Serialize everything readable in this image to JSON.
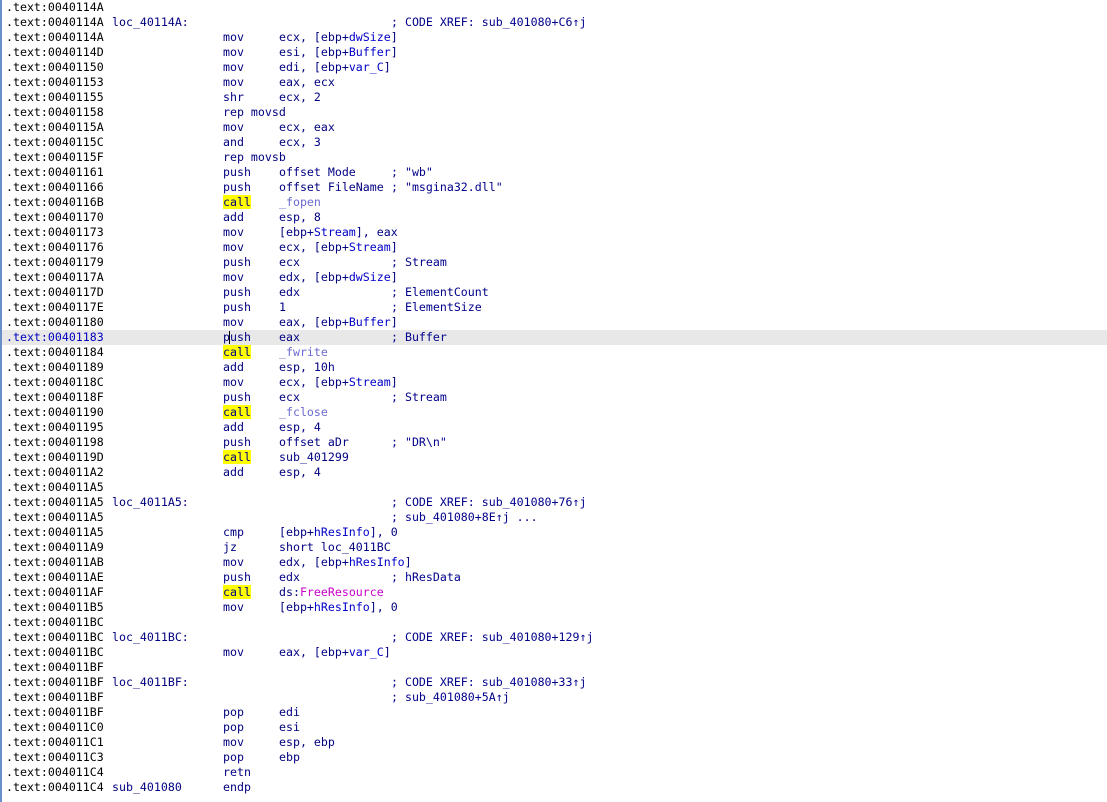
{
  "lines": [
    {
      "addr": ".text:0040114A"
    },
    {
      "addr": ".text:0040114A",
      "label": "loc_40114A:",
      "comment": "; CODE XREF: sub_401080+C6↑j"
    },
    {
      "addr": ".text:0040114A",
      "mnem": "mov",
      "ops": "ecx, [ebp+dwSize]"
    },
    {
      "addr": ".text:0040114D",
      "mnem": "mov",
      "ops": "esi, [ebp+Buffer]"
    },
    {
      "addr": ".text:00401150",
      "mnem": "mov",
      "ops": "edi, [ebp+var_C]"
    },
    {
      "addr": ".text:00401153",
      "mnem": "mov",
      "ops": "eax, ecx"
    },
    {
      "addr": ".text:00401155",
      "mnem": "shr",
      "ops": "ecx, 2"
    },
    {
      "addr": ".text:00401158",
      "mnem": "rep movsd"
    },
    {
      "addr": ".text:0040115A",
      "mnem": "mov",
      "ops": "ecx, eax"
    },
    {
      "addr": ".text:0040115C",
      "mnem": "and",
      "ops": "ecx, 3"
    },
    {
      "addr": ".text:0040115F",
      "mnem": "rep movsb"
    },
    {
      "addr": ".text:00401161",
      "mnem": "push",
      "ops": "offset Mode",
      "comment": "; \"wb\""
    },
    {
      "addr": ".text:00401166",
      "mnem": "push",
      "ops": "offset FileName",
      "comment": "; \"msgina32.dll\""
    },
    {
      "addr": ".text:0040116B",
      "mnem": "call",
      "ops": "_fopen",
      "call": true
    },
    {
      "addr": ".text:00401170",
      "mnem": "add",
      "ops": "esp, 8"
    },
    {
      "addr": ".text:00401173",
      "mnem": "mov",
      "ops": "[ebp+Stream], eax"
    },
    {
      "addr": ".text:00401176",
      "mnem": "mov",
      "ops": "ecx, [ebp+Stream]"
    },
    {
      "addr": ".text:00401179",
      "mnem": "push",
      "ops": "ecx",
      "comment": "; Stream"
    },
    {
      "addr": ".text:0040117A",
      "mnem": "mov",
      "ops": "edx, [ebp+dwSize]"
    },
    {
      "addr": ".text:0040117D",
      "mnem": "push",
      "ops": "edx",
      "comment": "; ElementCount"
    },
    {
      "addr": ".text:0040117E",
      "mnem": "push",
      "ops": "1",
      "comment": "; ElementSize"
    },
    {
      "addr": ".text:00401180",
      "mnem": "mov",
      "ops": "eax, [ebp+Buffer]"
    },
    {
      "addr": ".text:00401183",
      "mnem": "push",
      "ops": "eax",
      "comment": "; Buffer",
      "highlight": true
    },
    {
      "addr": ".text:00401184",
      "mnem": "call",
      "ops": "_fwrite",
      "call": true
    },
    {
      "addr": ".text:00401189",
      "mnem": "add",
      "ops": "esp, 10h"
    },
    {
      "addr": ".text:0040118C",
      "mnem": "mov",
      "ops": "ecx, [ebp+Stream]"
    },
    {
      "addr": ".text:0040118F",
      "mnem": "push",
      "ops": "ecx",
      "comment": "; Stream"
    },
    {
      "addr": ".text:00401190",
      "mnem": "call",
      "ops": "_fclose",
      "call": true
    },
    {
      "addr": ".text:00401195",
      "mnem": "add",
      "ops": "esp, 4"
    },
    {
      "addr": ".text:00401198",
      "mnem": "push",
      "ops": "offset aDr",
      "comment": "; \"DR\\n\""
    },
    {
      "addr": ".text:0040119D",
      "mnem": "call",
      "ops": "sub_401299",
      "call": true
    },
    {
      "addr": ".text:004011A2",
      "mnem": "add",
      "ops": "esp, 4"
    },
    {
      "addr": ".text:004011A5"
    },
    {
      "addr": ".text:004011A5",
      "label": "loc_4011A5:",
      "comment": "; CODE XREF: sub_401080+76↑j"
    },
    {
      "addr": ".text:004011A5",
      "comment": "; sub_401080+8E↑j ..."
    },
    {
      "addr": ".text:004011A5",
      "mnem": "cmp",
      "ops": "[ebp+hResInfo], 0"
    },
    {
      "addr": ".text:004011A9",
      "mnem": "jz",
      "ops": "short loc_4011BC"
    },
    {
      "addr": ".text:004011AB",
      "mnem": "mov",
      "ops": "edx, [ebp+hResInfo]"
    },
    {
      "addr": ".text:004011AE",
      "mnem": "push",
      "ops": "edx",
      "comment": "; hResData"
    },
    {
      "addr": ".text:004011AF",
      "mnem": "call",
      "ops": "ds:FreeResource",
      "call": true
    },
    {
      "addr": ".text:004011B5",
      "mnem": "mov",
      "ops": "[ebp+hResInfo], 0"
    },
    {
      "addr": ".text:004011BC"
    },
    {
      "addr": ".text:004011BC",
      "label": "loc_4011BC:",
      "comment": "; CODE XREF: sub_401080+129↑j"
    },
    {
      "addr": ".text:004011BC",
      "mnem": "mov",
      "ops": "eax, [ebp+var_C]"
    },
    {
      "addr": ".text:004011BF"
    },
    {
      "addr": ".text:004011BF",
      "label": "loc_4011BF:",
      "comment": "; CODE XREF: sub_401080+33↑j"
    },
    {
      "addr": ".text:004011BF",
      "comment": "; sub_401080+5A↑j"
    },
    {
      "addr": ".text:004011BF",
      "mnem": "pop",
      "ops": "edi"
    },
    {
      "addr": ".text:004011C0",
      "mnem": "pop",
      "ops": "esi"
    },
    {
      "addr": ".text:004011C1",
      "mnem": "mov",
      "ops": "esp, ebp"
    },
    {
      "addr": ".text:004011C3",
      "mnem": "pop",
      "ops": "ebp"
    },
    {
      "addr": ".text:004011C4",
      "mnem": "retn"
    },
    {
      "addr": ".text:004011C4",
      "label": "sub_401080",
      "mnem": "endp"
    }
  ],
  "colors": {
    "background": "#ffffff",
    "text": "#000080",
    "call_highlight": "#ffff00",
    "line_highlight": "#e8e8e8",
    "import_name": "#c800c8",
    "library_func": "#6b6bd0"
  }
}
